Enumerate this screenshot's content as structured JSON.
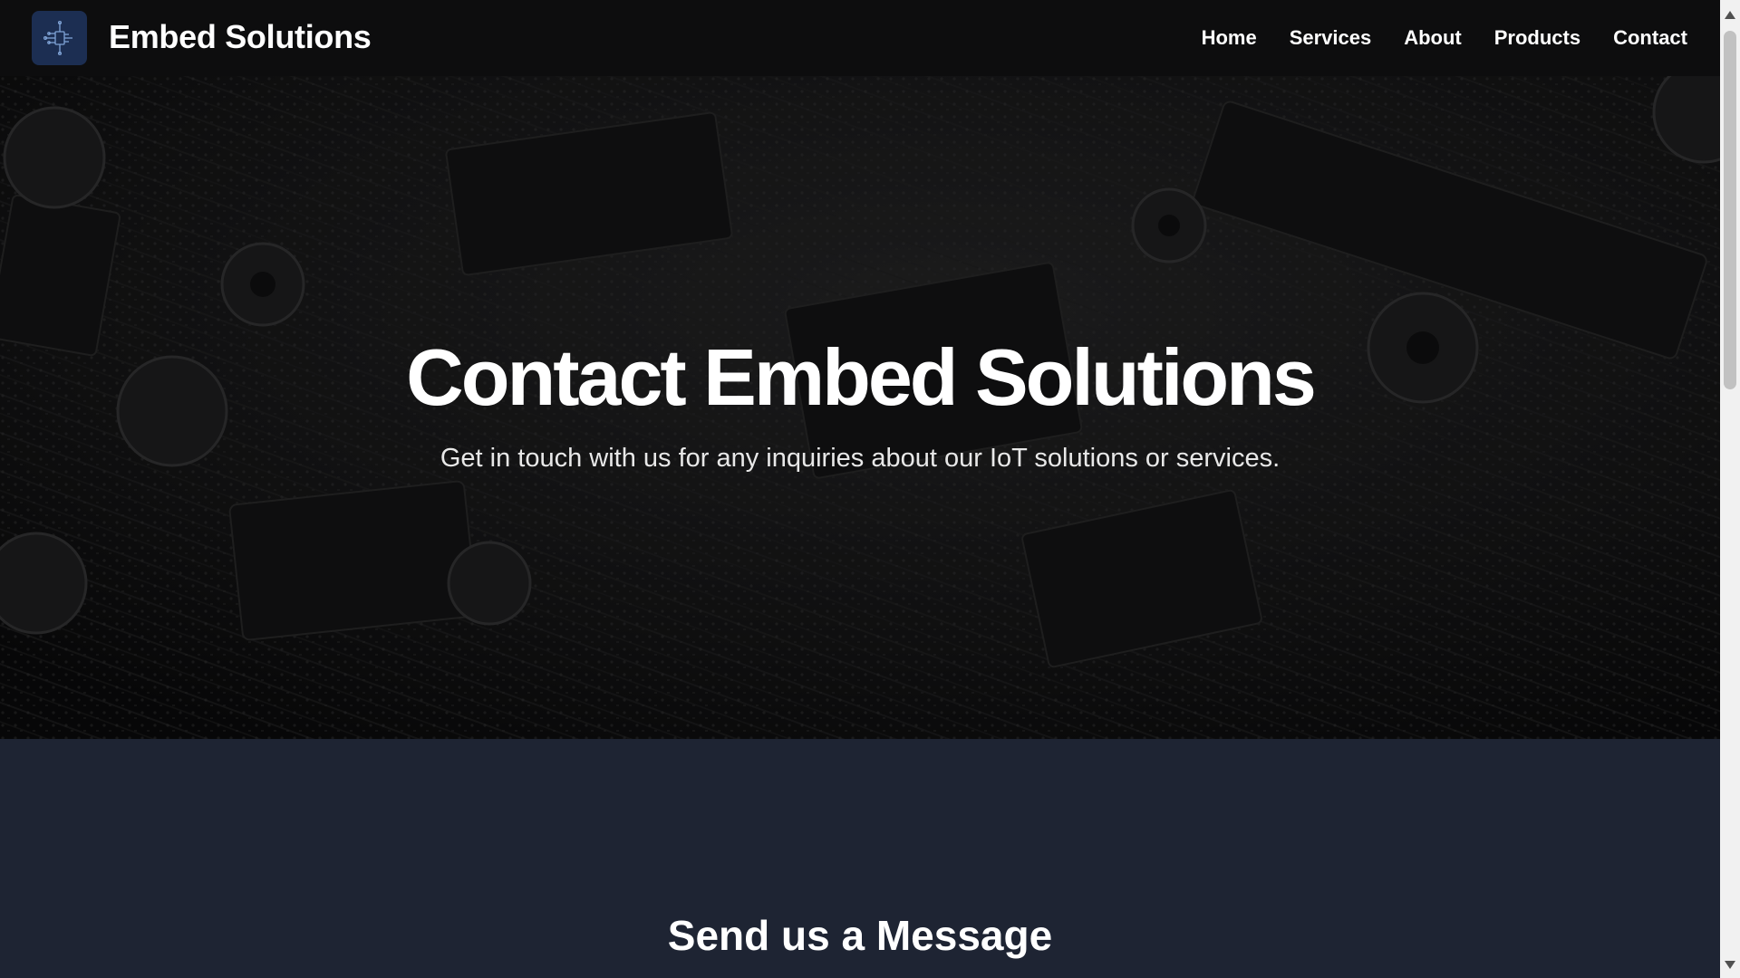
{
  "header": {
    "logo_icon": "circuit-chip-icon",
    "brand": "Embed Solutions",
    "nav": [
      {
        "label": "Home"
      },
      {
        "label": "Services"
      },
      {
        "label": "About"
      },
      {
        "label": "Products"
      },
      {
        "label": "Contact"
      }
    ]
  },
  "hero": {
    "title": "Contact Embed Solutions",
    "subtitle": "Get in touch with us for any inquiries about our IoT solutions or services."
  },
  "contact": {
    "section_title": "Send us a Message"
  },
  "colors": {
    "navbar_bg": "#0d0d0e",
    "logo_bg": "#1c2e52",
    "section_bg": "#1e2433"
  }
}
